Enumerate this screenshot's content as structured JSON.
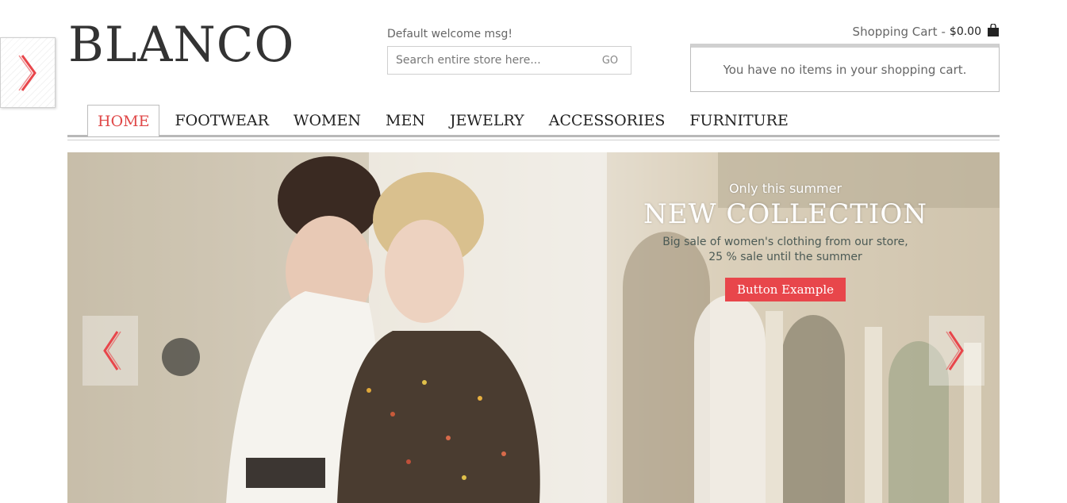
{
  "store": {
    "logo": "BLANCO",
    "welcome": "Default welcome msg!"
  },
  "search": {
    "placeholder": "Search entire store here...",
    "button": "GO"
  },
  "cart": {
    "label": "Shopping Cart",
    "separator": "-",
    "total": "$0.00",
    "empty_message": "You have no items in your shopping cart.",
    "icon": "shopping-bag-icon"
  },
  "nav": {
    "items": [
      "HOME",
      "FOOTWEAR",
      "WOMEN",
      "MEN",
      "JEWELRY",
      "ACCESSORIES",
      "FURNITURE"
    ],
    "active": "HOME"
  },
  "slider": {
    "kicker": "Only this summer",
    "title": "NEW COLLECTION",
    "description_line1": "Big sale of women's clothing from our store,",
    "description_line2": "25 % sale until the summer",
    "button": "Button Example",
    "prev_icon": "chevron-left-icon",
    "next_icon": "chevron-right-icon"
  },
  "side_panel": {
    "icon": "chevron-right-icon"
  },
  "colors": {
    "accent": "#e8464b",
    "active_nav": "#e04848",
    "text": "#333333",
    "muted": "#666666"
  }
}
